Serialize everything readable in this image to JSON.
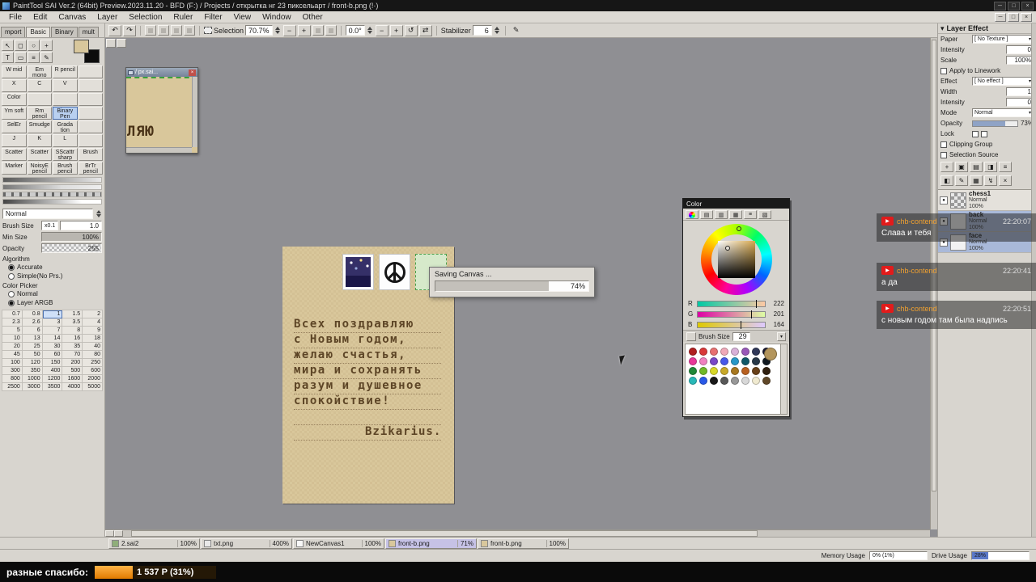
{
  "titlebar": {
    "title": "PaintTool SAI Ver.2 (64bit) Preview.2023.11.20 - BFD (F:) / Projects / открытка нг 23 пиксельарт / front-b.png (!·)",
    "minimize": "─",
    "maximize": "□",
    "close": "×"
  },
  "menubar": {
    "items": [
      "File",
      "Edit",
      "Canvas",
      "Layer",
      "Selection",
      "Ruler",
      "Filter",
      "View",
      "Window",
      "Other"
    ],
    "mdi_min": "─",
    "mdi_restore": "□",
    "mdi_close": "×"
  },
  "left_tabs": {
    "items": [
      "mport",
      "Basic",
      "Binary",
      "mult"
    ]
  },
  "toolbar": {
    "undo_icon": "↶",
    "redo_icon": "↷",
    "selection_label": "Selection",
    "zoom_value": "70.7%",
    "zoom_out": "−",
    "zoom_in": "+",
    "angle_value": "0.0°",
    "rot_ccw": "−",
    "rot_cw": "+",
    "reset_icon": "↺",
    "flip_icon": "⇄",
    "stabilizer_label": "Stabilizer",
    "stabilizer_value": "6",
    "pen_icon": "✎"
  },
  "tool_panel": {
    "quick_icons": [
      "↖",
      "◻",
      "○",
      "+",
      "T",
      "▭",
      "≡",
      "✎"
    ],
    "fg_color": "#d8c79c",
    "bg_color": "#0c0c0c",
    "tools": [
      "W mid",
      "Em mono",
      "R pencil",
      "",
      "X",
      "C",
      "V",
      "",
      "Color",
      "",
      "",
      "",
      "Ym soft",
      "Rm pencil",
      "Binary Pen",
      "",
      "SelEr",
      "Smudge",
      "Grada tion",
      "",
      "J",
      "K",
      "L",
      "",
      "Scatter",
      "Scatter",
      "SScattr sharp",
      "Brush",
      "Marker",
      "NoisyE pencil",
      "Brush pencil",
      "BrTr pencil"
    ],
    "mode_value": "Normal",
    "brush_size_label": "Brush Size",
    "brush_size_mult": "x0.1",
    "brush_size_value": "1.0",
    "min_size_label": "Min Size",
    "min_size_value": "100%",
    "opacity_label": "Opacity",
    "opacity_value": "255",
    "algorithm_label": "Algorithm",
    "algorithm_opt1": "Accurate",
    "algorithm_opt2": "Simple(No Prs.)",
    "picker_label": "Color Picker",
    "picker_opt1": "Normal",
    "picker_opt2": "Layer ARGB",
    "sizes": [
      [
        "0.7",
        "0.8",
        "1",
        "1.5",
        "2"
      ],
      [
        "2.3",
        "2.6",
        "3",
        "3.5",
        "4"
      ],
      [
        "5",
        "6",
        "7",
        "8",
        "9"
      ],
      [
        "10",
        "13",
        "14",
        "16",
        "18"
      ],
      [
        "20",
        "25",
        "30",
        "35",
        "40"
      ],
      [
        "45",
        "50",
        "60",
        "70",
        "80"
      ],
      [
        "100",
        "120",
        "150",
        "200",
        "250"
      ],
      [
        "300",
        "350",
        "400",
        "500",
        "600"
      ],
      [
        "800",
        "1000",
        "1200",
        "1600",
        "2000"
      ],
      [
        "2500",
        "3000",
        "3500",
        "4000",
        "5000"
      ]
    ]
  },
  "mini_window": {
    "title": "/ px.sai...",
    "close": "×",
    "text": "ЛЯЮ"
  },
  "postcard": {
    "lines": [
      "Всех поздравляю",
      "с Новым годом,",
      "желаю счастья,",
      "мира и сохранять",
      "разум и душевное",
      "спокойствие!"
    ],
    "signature": "Bzikarius."
  },
  "saving_dialog": {
    "message": "Saving Canvas ...",
    "percent": "74%",
    "fill": "74%"
  },
  "color_panel": {
    "title": "Color",
    "tab_icons": [
      "",
      "▤",
      "▥",
      "▦",
      "≡",
      "▧"
    ],
    "r_label": "R",
    "r_value": "222",
    "g_label": "G",
    "g_value": "201",
    "b_label": "B",
    "b_value": "164",
    "brush_size_label": "Brush Size",
    "brush_size_value": "29",
    "current_color": "#dec9a4",
    "big_swatch": "#b3955c",
    "swatches": [
      "#b02020",
      "#d83838",
      "#e87070",
      "#f0a8b8",
      "#d8b0d8",
      "#9858b8",
      "#303858",
      "#181830",
      "#e83898",
      "#f080c0",
      "#7848c8",
      "#4858e8",
      "#2898c8",
      "#105868",
      "#283848",
      "#101820",
      "#208838",
      "#70b828",
      "#d8d828",
      "#c8a828",
      "#a87820",
      "#b86020",
      "#684018",
      "#302010",
      "#28b8b8",
      "#2858e8",
      "#181818",
      "#585858",
      "#989898",
      "#d8d8d8",
      "#f0ead0",
      "#604828"
    ]
  },
  "layer_panel": {
    "collapse_icon": "▾",
    "header": "Layer Effect",
    "paper_label": "Paper",
    "paper_value": "[ No Texture ]",
    "intensity_label": "Intensity",
    "intensity_value": "0",
    "scale_label": "Scale",
    "scale_value": "100%",
    "linework_label": "Apply to Linework",
    "effect_label": "Effect",
    "effect_value": "[ No effect ]",
    "width_label": "Width",
    "width_value": "1",
    "intensity2_label": "Intensity",
    "intensity2_value": "0",
    "mode_label": "Mode",
    "mode_value": "Normal",
    "opacity_label": "Opacity",
    "opacity_value": "73%",
    "opacity_fill": "73%",
    "lock_label": "Lock",
    "clipping_label": "Clipping Group",
    "selsrc_label": "Selection Source",
    "icons_row1": [
      "+",
      "▣",
      "▤",
      "◨",
      "≡"
    ],
    "icons_row2": [
      "◧",
      "✎",
      "▦",
      "↯",
      "×"
    ],
    "layers": [
      {
        "name": "chess1",
        "mode": "Normal",
        "opacity": "100%"
      },
      {
        "name": "back",
        "mode": "Normal",
        "opacity": "100%"
      },
      {
        "name": "face",
        "mode": "Normal",
        "opacity": "100%"
      }
    ]
  },
  "chat": {
    "yt_icon": "▶",
    "messages": [
      {
        "user": "chb-contend",
        "time": "22:20:07",
        "text": "Слава и тебя"
      },
      {
        "user": "chb-contend",
        "time": "22:20:41",
        "text": "а да"
      },
      {
        "user": "chb-contend",
        "time": "22:20:51",
        "text": "с новым годом там была надпись"
      }
    ]
  },
  "doc_tabs": {
    "tabs": [
      {
        "name": "2.sai2",
        "zoom": "100%",
        "icon_color": "#8fae7a"
      },
      {
        "name": "txt.png",
        "zoom": "400%",
        "icon_color": "#e8e8e8"
      },
      {
        "name": "NewCanvas1",
        "zoom": "100%",
        "icon_color": "#f8f8f8"
      },
      {
        "name": "front-b.png",
        "zoom": "71%",
        "icon_color": "#d8c79c"
      },
      {
        "name": "front-b.png",
        "zoom": "100%",
        "icon_color": "#d8c79c"
      }
    ]
  },
  "statusbar": {
    "memory_label": "Memory Usage",
    "memory_value": "0% (1%)",
    "drive_label": "Drive Usage",
    "drive_value": "28%",
    "drive_fill": "28%"
  },
  "bottom_bar": {
    "label": "разные спасибо:",
    "amount": "1 537 Р (31%)",
    "fill": "31%"
  }
}
